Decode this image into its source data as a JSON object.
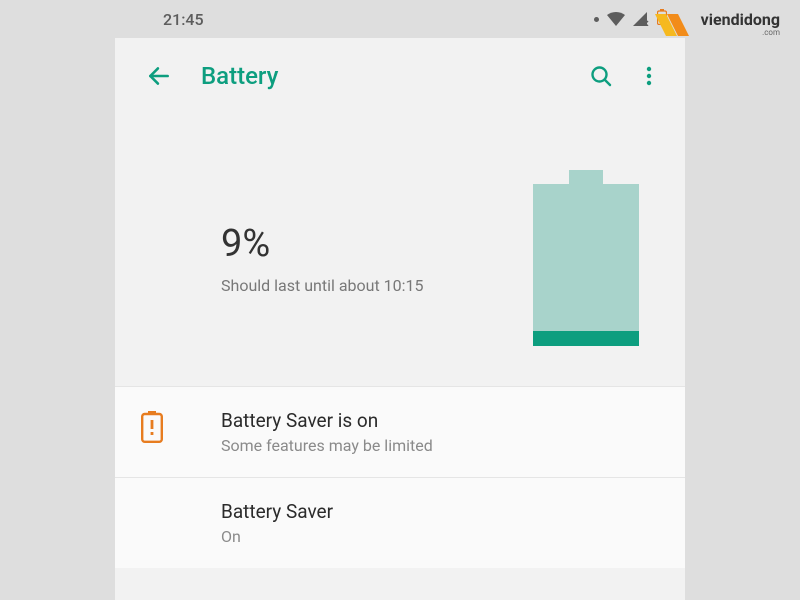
{
  "status_bar": {
    "time": "21:45"
  },
  "header": {
    "title": "Battery"
  },
  "summary": {
    "percentage": "9%",
    "estimate": "Should last until about 10:15"
  },
  "saver_notice": {
    "title": "Battery Saver is on",
    "subtitle": "Some features may be limited"
  },
  "saver_setting": {
    "title": "Battery Saver",
    "subtitle": "On"
  },
  "watermark": {
    "name": "viendidong",
    "suffix": ".com"
  },
  "colors": {
    "accent": "#0d9e7f",
    "battery_body": "#a8d3cb",
    "saver_icon": "#e77c1f"
  }
}
